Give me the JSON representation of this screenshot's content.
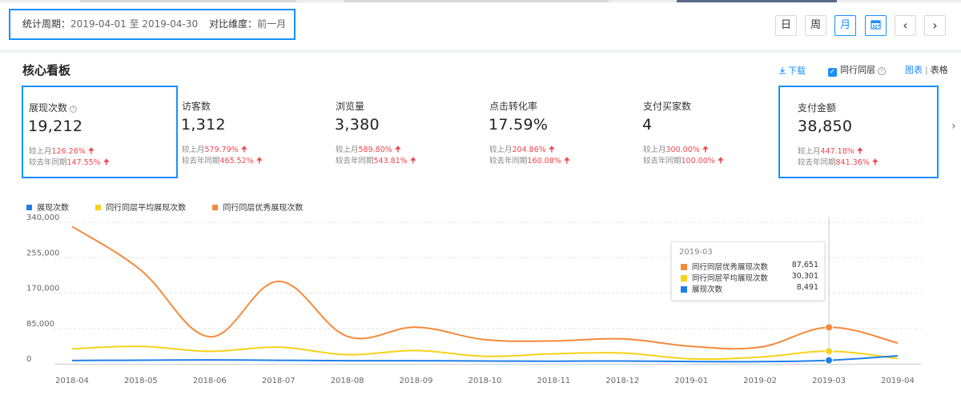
{
  "filter": {
    "period_label": "统计周期：",
    "period_value": "2019-04-01 至 2019-04-30",
    "compare_label": "对比维度：",
    "compare_value": "前一月"
  },
  "controls": {
    "day": "日",
    "week": "周",
    "month": "月",
    "prev": "‹",
    "next": "›"
  },
  "panel": {
    "title": "核心看板",
    "download": "下载",
    "peer_label": "同行同层",
    "view_chart": "图表",
    "view_sep": "|",
    "view_table": "表格"
  },
  "kpis": [
    {
      "name": "展现次数",
      "value": "19,212",
      "mom_label": "较上月",
      "mom": "126.26%",
      "yoy_label": "较去年同期",
      "yoy": "147.55%",
      "selected": true,
      "help": true
    },
    {
      "name": "访客数",
      "value": "1,312",
      "mom_label": "较上月",
      "mom": "579.79%",
      "yoy_label": "较去年同期",
      "yoy": "465.52%",
      "selected": false,
      "help": false
    },
    {
      "name": "浏览量",
      "value": "3,380",
      "mom_label": "较上月",
      "mom": "589.80%",
      "yoy_label": "较去年同期",
      "yoy": "543.81%",
      "selected": false,
      "help": false
    },
    {
      "name": "点击转化率",
      "value": "17.59%",
      "mom_label": "较上月",
      "mom": "204.86%",
      "yoy_label": "较去年同期",
      "yoy": "160.08%",
      "selected": false,
      "help": false
    },
    {
      "name": "支付买家数",
      "value": "4",
      "mom_label": "较上月",
      "mom": "300.00%",
      "yoy_label": "较去年同期",
      "yoy": "100.00%",
      "selected": false,
      "help": false
    },
    {
      "name": "支付金额",
      "value": "38,850",
      "mom_label": "较上月",
      "mom": "447.18%",
      "yoy_label": "较去年同期",
      "yoy": "841.36%",
      "selected": true,
      "help": false
    }
  ],
  "chart_data": {
    "type": "line",
    "x": [
      "2018-04",
      "2018-05",
      "2018-06",
      "2018-07",
      "2018-08",
      "2018-09",
      "2018-10",
      "2018-11",
      "2018-12",
      "2019-01",
      "2019-02",
      "2019-03",
      "2019-04"
    ],
    "y_ticks": [
      "0",
      "85,000",
      "170,000",
      "255,000",
      "340,000"
    ],
    "ylim": [
      0,
      340000
    ],
    "grid": "horizontal-dashed",
    "legend_position": "top-left",
    "series": [
      {
        "name": "展现次数",
        "color": "#1f7fe8",
        "values": [
          8000,
          8700,
          9400,
          8500,
          7500,
          7500,
          6800,
          6300,
          6800,
          5500,
          5300,
          8491,
          19212
        ]
      },
      {
        "name": "同行同层平均展现次数",
        "color": "#f5d21a",
        "values": [
          36000,
          42000,
          30000,
          40000,
          22000,
          32000,
          18000,
          24000,
          26000,
          12000,
          16000,
          30301,
          13000
        ]
      },
      {
        "name": "同行同层优秀展现次数",
        "color": "#f58a3c",
        "values": [
          330000,
          225000,
          65000,
          198000,
          66000,
          88000,
          58000,
          55000,
          60000,
          42000,
          40000,
          87651,
          50000
        ]
      }
    ],
    "tooltip": {
      "title": "2019-03",
      "rows": [
        {
          "name": "同行同层优秀展现次数",
          "value": "87,651",
          "color": "#f58a3c"
        },
        {
          "name": "同行同层平均展现次数",
          "value": "30,301",
          "color": "#f5d21a"
        },
        {
          "name": "展现次数",
          "value": "8,491",
          "color": "#1f7fe8"
        }
      ]
    }
  }
}
